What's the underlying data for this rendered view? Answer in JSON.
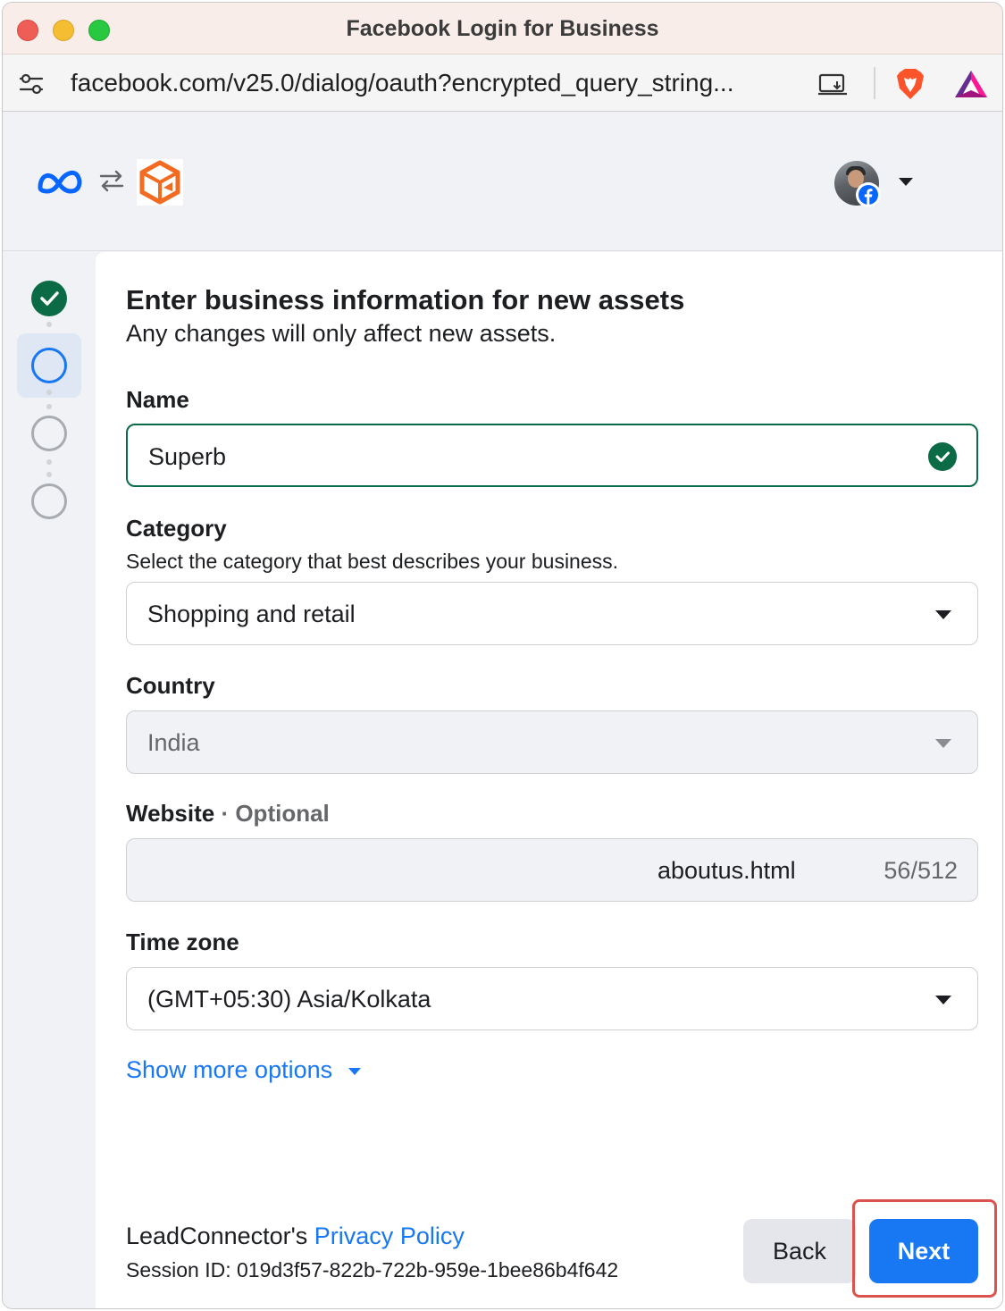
{
  "window": {
    "title": "Facebook Login for Business"
  },
  "addressbar": {
    "url": "facebook.com/v25.0/dialog/oauth?encrypted_query_string..."
  },
  "header": {
    "account_menu": "account-menu"
  },
  "stepper": {
    "steps": [
      "complete",
      "current",
      "upcoming",
      "upcoming"
    ]
  },
  "form": {
    "title": "Enter business information for new assets",
    "subtitle": "Any changes will only affect new assets.",
    "name": {
      "label": "Name",
      "value": "Superb"
    },
    "category": {
      "label": "Category",
      "helper": "Select the category that best describes your business.",
      "value": "Shopping and retail"
    },
    "country": {
      "label": "Country",
      "value": "India"
    },
    "website": {
      "label": "Website",
      "optional": "· Optional",
      "value": "aboutus.html",
      "counter": "56/512"
    },
    "timezone": {
      "label": "Time zone",
      "value": "(GMT+05:30) Asia/Kolkata"
    },
    "more_options": "Show more options"
  },
  "footer": {
    "policy_prefix": "LeadConnector's ",
    "policy_link": "Privacy Policy",
    "session": "Session ID: 019d3f57-822b-722b-959e-1bee86b4f642",
    "back_label": "Back",
    "next_label": "Next"
  },
  "colors": {
    "accent": "#1877f2",
    "success": "#0a6b46",
    "highlight": "#d9534f"
  }
}
